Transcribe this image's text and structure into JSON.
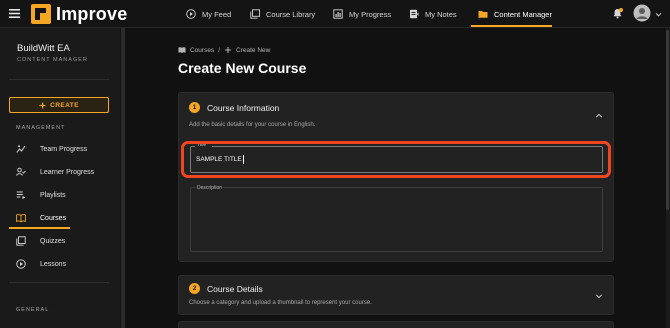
{
  "app": {
    "name": "Improve"
  },
  "topnav": {
    "items": [
      {
        "label": "My Feed",
        "icon": "play-circle-icon"
      },
      {
        "label": "Course Library",
        "icon": "library-icon"
      },
      {
        "label": "My Progress",
        "icon": "chart-icon"
      },
      {
        "label": "My Notes",
        "icon": "notes-icon"
      },
      {
        "label": "Content Manager",
        "icon": "folder-icon",
        "active": true
      }
    ]
  },
  "sidebar": {
    "org_name": "BuildWitt EA",
    "role": "CONTENT MANAGER",
    "create_label": "CREATE",
    "management_label": "MANAGEMENT",
    "general_label": "GENERAL",
    "items": [
      {
        "label": "Team Progress",
        "icon": "team-progress-icon"
      },
      {
        "label": "Learner Progress",
        "icon": "learner-progress-icon"
      },
      {
        "label": "Playlists",
        "icon": "playlist-icon"
      },
      {
        "label": "Courses",
        "icon": "courses-icon",
        "active": true
      },
      {
        "label": "Quizzes",
        "icon": "quizzes-icon"
      },
      {
        "label": "Lessons",
        "icon": "lessons-icon"
      }
    ]
  },
  "breadcrumb": {
    "parent": "Courses",
    "separator": "/",
    "current": "Create New"
  },
  "page": {
    "title": "Create New Course"
  },
  "course_info": {
    "step": "1",
    "title": "Course Information",
    "description": "Add the basic details for your course in English.",
    "title_field": {
      "label": "Title *",
      "value": "SAMPLE TITLE"
    },
    "description_field": {
      "label": "Description",
      "value": ""
    }
  },
  "course_details": {
    "step": "2",
    "title": "Course Details",
    "description": "Choose a category and upload a thumbnail to represent your course."
  },
  "colors": {
    "accent": "#f5a623",
    "highlight": "#f0451e",
    "background": "#111111",
    "card": "#222222"
  }
}
